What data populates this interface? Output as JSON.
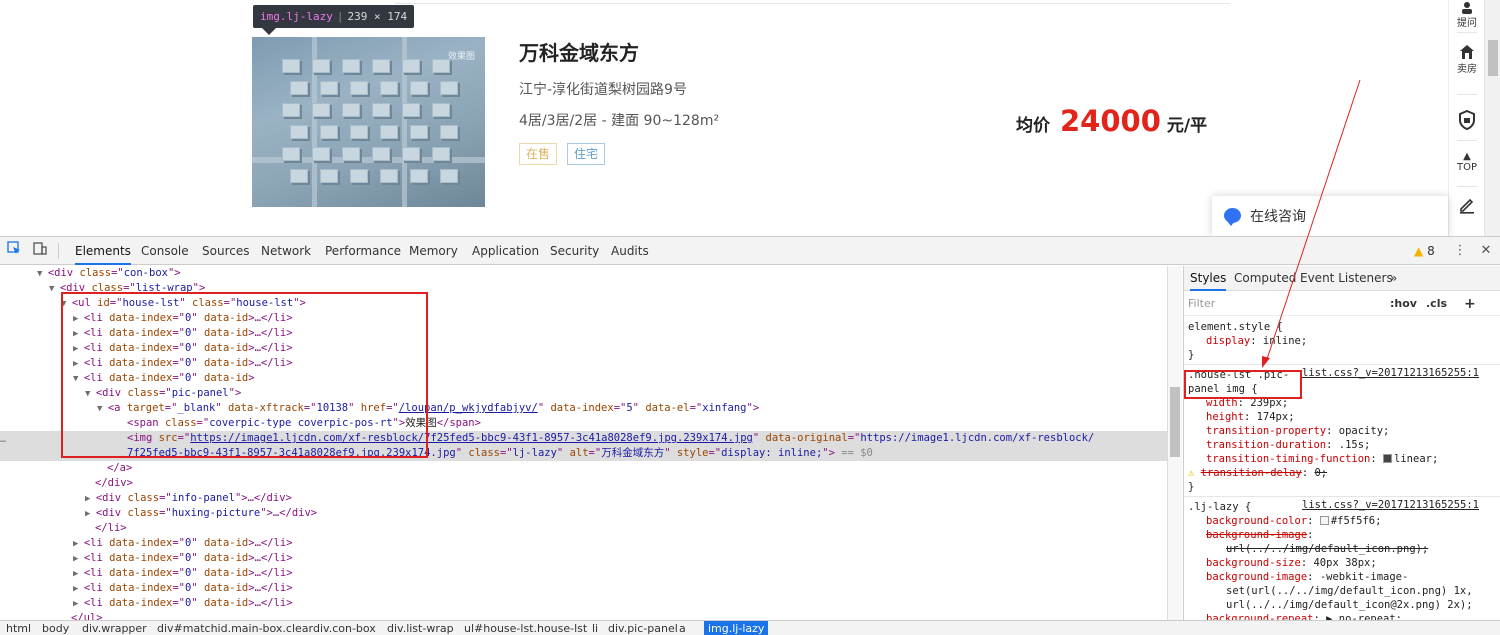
{
  "page": {
    "tooltip": {
      "tag": "img.lj-lazy",
      "dims": "239 × 174"
    },
    "image_watermark": "效果图",
    "house": {
      "title": "万科金域东方",
      "address": "江宁-淳化街道梨树园路9号",
      "rooms": "4居/3居/2居 - 建面 90~128m²",
      "tags": [
        "在售",
        "住宅"
      ],
      "price_label": "均价",
      "price_value": "24000",
      "price_unit": "元/平"
    },
    "sidebar": [
      {
        "icon": "question-icon",
        "label": "提问"
      },
      {
        "icon": "house-icon",
        "label": "卖房"
      },
      {
        "icon": "shield-icon",
        "label": ""
      },
      {
        "icon": "top-icon",
        "label": "TOP"
      },
      {
        "icon": "edit-icon",
        "label": ""
      }
    ],
    "consult": "在线咨询"
  },
  "devtools": {
    "tabs": [
      "Elements",
      "Console",
      "Sources",
      "Network",
      "Performance",
      "Memory",
      "Application",
      "Security",
      "Audits"
    ],
    "active_tab": "Elements",
    "warnings": "8",
    "styles_tabs": [
      "Styles",
      "Computed",
      "Event Listeners",
      "»"
    ],
    "filter_placeholder": "Filter",
    "filter_hov": ":hov",
    "filter_cls": ".cls",
    "filter_plus": "+",
    "dom": [
      {
        "indent": 0,
        "tri": "▼",
        "parts": [
          [
            "tag",
            "<div "
          ],
          [
            "attr",
            "class"
          ],
          [
            "tag",
            "=\""
          ],
          [
            "val",
            "con-box"
          ],
          [
            "tag",
            "\">"
          ]
        ]
      },
      {
        "indent": 1,
        "tri": "▼",
        "parts": [
          [
            "tag",
            "<div "
          ],
          [
            "attr",
            "class"
          ],
          [
            "tag",
            "=\""
          ],
          [
            "val",
            "list-wrap"
          ],
          [
            "tag",
            "\">"
          ]
        ]
      },
      {
        "indent": 2,
        "tri": "▼",
        "parts": [
          [
            "tag",
            "<ul "
          ],
          [
            "attr",
            "id"
          ],
          [
            "tag",
            "=\""
          ],
          [
            "val",
            "house-lst"
          ],
          [
            "tag",
            "\" "
          ],
          [
            "attr",
            "class"
          ],
          [
            "tag",
            "=\""
          ],
          [
            "val",
            "house-lst"
          ],
          [
            "tag",
            "\">"
          ]
        ]
      },
      {
        "indent": 3,
        "tri": "▶",
        "parts": [
          [
            "tag",
            "<li "
          ],
          [
            "attr",
            "data-index"
          ],
          [
            "tag",
            "=\""
          ],
          [
            "val",
            "0"
          ],
          [
            "tag",
            "\" "
          ],
          [
            "attr",
            "data-id"
          ],
          [
            "tag",
            ">…</li>"
          ]
        ]
      },
      {
        "indent": 3,
        "tri": "▶",
        "parts": [
          [
            "tag",
            "<li "
          ],
          [
            "attr",
            "data-index"
          ],
          [
            "tag",
            "=\""
          ],
          [
            "val",
            "0"
          ],
          [
            "tag",
            "\" "
          ],
          [
            "attr",
            "data-id"
          ],
          [
            "tag",
            ">…</li>"
          ]
        ]
      },
      {
        "indent": 3,
        "tri": "▶",
        "parts": [
          [
            "tag",
            "<li "
          ],
          [
            "attr",
            "data-index"
          ],
          [
            "tag",
            "=\""
          ],
          [
            "val",
            "0"
          ],
          [
            "tag",
            "\" "
          ],
          [
            "attr",
            "data-id"
          ],
          [
            "tag",
            ">…</li>"
          ]
        ]
      },
      {
        "indent": 3,
        "tri": "▶",
        "parts": [
          [
            "tag",
            "<li "
          ],
          [
            "attr",
            "data-index"
          ],
          [
            "tag",
            "=\""
          ],
          [
            "val",
            "0"
          ],
          [
            "tag",
            "\" "
          ],
          [
            "attr",
            "data-id"
          ],
          [
            "tag",
            ">…</li>"
          ]
        ]
      },
      {
        "indent": 3,
        "tri": "▼",
        "parts": [
          [
            "tag",
            "<li "
          ],
          [
            "attr",
            "data-index"
          ],
          [
            "tag",
            "=\""
          ],
          [
            "val",
            "0"
          ],
          [
            "tag",
            "\" "
          ],
          [
            "attr",
            "data-id"
          ],
          [
            "tag",
            ">"
          ]
        ]
      },
      {
        "indent": 4,
        "tri": "▼",
        "parts": [
          [
            "tag",
            "<div "
          ],
          [
            "attr",
            "class"
          ],
          [
            "tag",
            "=\""
          ],
          [
            "val",
            "pic-panel"
          ],
          [
            "tag",
            "\">"
          ]
        ]
      },
      {
        "indent": 5,
        "tri": "▼",
        "parts": [
          [
            "tag",
            "<a "
          ],
          [
            "attr",
            "target"
          ],
          [
            "tag",
            "=\""
          ],
          [
            "val",
            "_blank"
          ],
          [
            "tag",
            "\" "
          ],
          [
            "attr",
            "data-xftrack"
          ],
          [
            "tag",
            "=\""
          ],
          [
            "val",
            "10138"
          ],
          [
            "tag",
            "\" "
          ],
          [
            "attr",
            "href"
          ],
          [
            "tag",
            "=\""
          ],
          [
            "link",
            "/loupan/p_wkjydfabjyv/"
          ],
          [
            "tag",
            "\" "
          ],
          [
            "attr",
            "data-index"
          ],
          [
            "tag",
            "=\""
          ],
          [
            "val",
            "5"
          ],
          [
            "tag",
            "\" "
          ],
          [
            "attr",
            "data-el"
          ],
          [
            "tag",
            "=\""
          ],
          [
            "val",
            "xinfang"
          ],
          [
            "tag",
            "\">"
          ]
        ]
      },
      {
        "indent": 6,
        "tri": "",
        "parts": [
          [
            "tag",
            "<span "
          ],
          [
            "attr",
            "class"
          ],
          [
            "tag",
            "=\""
          ],
          [
            "val",
            "coverpic-type coverpic-pos-rt"
          ],
          [
            "tag",
            "\">"
          ],
          [
            "text",
            "效果图"
          ],
          [
            "tag",
            "</span>"
          ]
        ]
      },
      {
        "indent": 6,
        "tri": "",
        "selected": true,
        "parts": [
          [
            "tag",
            "<img "
          ],
          [
            "attr",
            "src"
          ],
          [
            "tag",
            "=\""
          ],
          [
            "link",
            "https://image1.ljcdn.com/xf-resblock/7f25fed5-bbc9-43f1-8957-3c41a8028ef9.jpg.239x174.jpg"
          ],
          [
            "tag",
            "\" "
          ],
          [
            "attr",
            "data-original"
          ],
          [
            "tag",
            "=\""
          ],
          [
            "val",
            "https://image1.ljcdn.com/xf-resblock/"
          ]
        ]
      },
      {
        "indent": 6,
        "tri": "",
        "selected": true,
        "parts": [
          [
            "val",
            "7f25fed5-bbc9-43f1-8957-3c41a8028ef9.jpg.239x174.jpg"
          ],
          [
            "tag",
            "\" "
          ],
          [
            "attr",
            "class"
          ],
          [
            "tag",
            "=\""
          ],
          [
            "val",
            "lj-lazy"
          ],
          [
            "tag",
            "\" "
          ],
          [
            "attr",
            "alt"
          ],
          [
            "tag",
            "=\""
          ],
          [
            "val",
            "万科金域东方"
          ],
          [
            "tag",
            "\" "
          ],
          [
            "attr",
            "style"
          ],
          [
            "tag",
            "=\""
          ],
          [
            "val",
            "display: inline;"
          ],
          [
            "tag",
            "\">"
          ],
          [
            "eq",
            " == $0"
          ]
        ]
      },
      {
        "indent": 5,
        "tri": "",
        "parts": [
          [
            "tag",
            "</a>"
          ]
        ]
      },
      {
        "indent": 4,
        "tri": "",
        "parts": [
          [
            "tag",
            "</div>"
          ]
        ]
      },
      {
        "indent": 4,
        "tri": "▶",
        "parts": [
          [
            "tag",
            "<div "
          ],
          [
            "attr",
            "class"
          ],
          [
            "tag",
            "=\""
          ],
          [
            "val",
            "info-panel"
          ],
          [
            "tag",
            "\">…</div>"
          ]
        ]
      },
      {
        "indent": 4,
        "tri": "▶",
        "parts": [
          [
            "tag",
            "<div "
          ],
          [
            "attr",
            "class"
          ],
          [
            "tag",
            "=\""
          ],
          [
            "val",
            "huxing-picture"
          ],
          [
            "tag",
            "\">…</div>"
          ]
        ]
      },
      {
        "indent": 4,
        "tri": "",
        "parts": [
          [
            "tag",
            "</li>"
          ]
        ]
      },
      {
        "indent": 3,
        "tri": "▶",
        "parts": [
          [
            "tag",
            "<li "
          ],
          [
            "attr",
            "data-index"
          ],
          [
            "tag",
            "=\""
          ],
          [
            "val",
            "0"
          ],
          [
            "tag",
            "\" "
          ],
          [
            "attr",
            "data-id"
          ],
          [
            "tag",
            ">…</li>"
          ]
        ]
      },
      {
        "indent": 3,
        "tri": "▶",
        "parts": [
          [
            "tag",
            "<li "
          ],
          [
            "attr",
            "data-index"
          ],
          [
            "tag",
            "=\""
          ],
          [
            "val",
            "0"
          ],
          [
            "tag",
            "\" "
          ],
          [
            "attr",
            "data-id"
          ],
          [
            "tag",
            ">…</li>"
          ]
        ]
      },
      {
        "indent": 3,
        "tri": "▶",
        "parts": [
          [
            "tag",
            "<li "
          ],
          [
            "attr",
            "data-index"
          ],
          [
            "tag",
            "=\""
          ],
          [
            "val",
            "0"
          ],
          [
            "tag",
            "\" "
          ],
          [
            "attr",
            "data-id"
          ],
          [
            "tag",
            ">…</li>"
          ]
        ]
      },
      {
        "indent": 3,
        "tri": "▶",
        "parts": [
          [
            "tag",
            "<li "
          ],
          [
            "attr",
            "data-index"
          ],
          [
            "tag",
            "=\""
          ],
          [
            "val",
            "0"
          ],
          [
            "tag",
            "\" "
          ],
          [
            "attr",
            "data-id"
          ],
          [
            "tag",
            ">…</li>"
          ]
        ]
      },
      {
        "indent": 3,
        "tri": "▶",
        "parts": [
          [
            "tag",
            "<li "
          ],
          [
            "attr",
            "data-index"
          ],
          [
            "tag",
            "=\""
          ],
          [
            "val",
            "0"
          ],
          [
            "tag",
            "\" "
          ],
          [
            "attr",
            "data-id"
          ],
          [
            "tag",
            ">…</li>"
          ]
        ]
      },
      {
        "indent": 2,
        "tri": "",
        "parts": [
          [
            "tag",
            "</ul>"
          ]
        ]
      }
    ],
    "styles": [
      {
        "kind": "sel",
        "text": "element.style {"
      },
      {
        "kind": "prop",
        "name": "display",
        "value": "inline;"
      },
      {
        "kind": "close",
        "text": "}"
      },
      {
        "kind": "sep"
      },
      {
        "kind": "sel",
        "text": ".house-lst .pic-",
        "link": "list.css?_v=20171213165255:1"
      },
      {
        "kind": "sel",
        "text": "panel img {"
      },
      {
        "kind": "prop",
        "name": "width",
        "value": "239px;"
      },
      {
        "kind": "prop",
        "name": "height",
        "value": "174px;"
      },
      {
        "kind": "prop",
        "name": "transition-property",
        "value": "opacity;"
      },
      {
        "kind": "prop",
        "name": "transition-duration",
        "value": ".15s;"
      },
      {
        "kind": "prop",
        "name": "transition-timing-function",
        "value": "linear;",
        "ease": true
      },
      {
        "kind": "prop",
        "name": "transition-delay",
        "value": "0;",
        "struck": true,
        "warn": true
      },
      {
        "kind": "close",
        "text": "}"
      },
      {
        "kind": "sep"
      },
      {
        "kind": "sel",
        "text": ".lj-lazy {",
        "link": "list.css?_v=20171213165255:1"
      },
      {
        "kind": "prop",
        "name": "background-color",
        "value": "#f5f5f6;",
        "swatch": "#f5f5f6"
      },
      {
        "kind": "prop",
        "name": "background-image",
        "value": "",
        "struck": true
      },
      {
        "kind": "cont",
        "text": "url(../../img/default_icon.png);",
        "struck": true
      },
      {
        "kind": "prop",
        "name": "background-size",
        "value": "40px 38px;"
      },
      {
        "kind": "prop",
        "name": "background-image",
        "value": "-webkit-image-"
      },
      {
        "kind": "cont",
        "text": "set(url(../../img/default_icon.png) 1x,"
      },
      {
        "kind": "cont",
        "text": "url(../../img/default_icon@2x.png) 2x);"
      },
      {
        "kind": "prop",
        "name": "background-repeat",
        "value": "no-repeat;",
        "tri": true
      }
    ],
    "breadcrumbs": [
      "html",
      "body",
      "div.wrapper",
      "div#matchid.main-box.clear",
      "div.con-box",
      "div.list-wrap",
      "ul#house-lst.house-lst",
      "li",
      "div.pic-panel",
      "a",
      "img.lj-lazy"
    ],
    "active_crumb": "img.lj-lazy"
  },
  "colors": {
    "accent": "#1a73e8",
    "price": "#e1251b",
    "highlight": "#e02020"
  }
}
